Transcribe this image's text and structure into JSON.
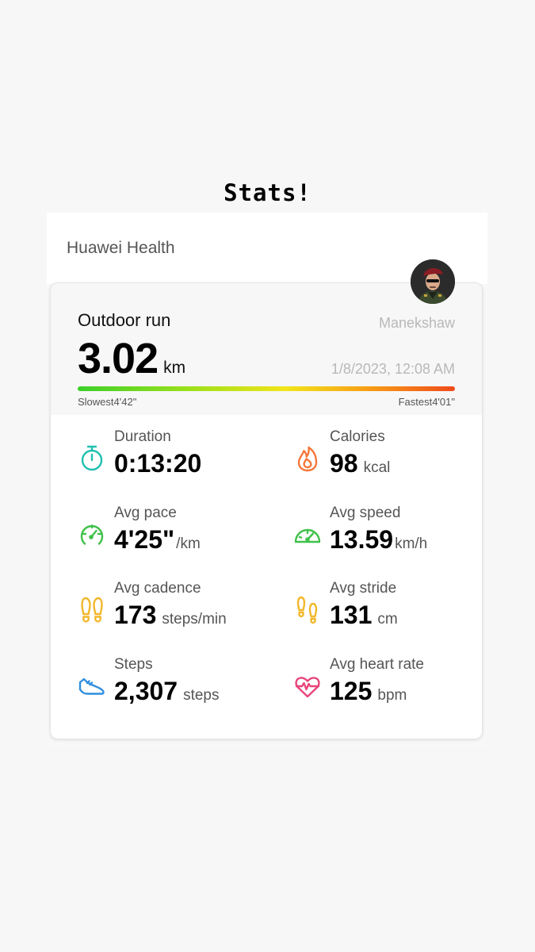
{
  "caption": "Stats!",
  "app": {
    "name": "Huawei Health"
  },
  "workout": {
    "title": "Outdoor run",
    "distance": "3.02",
    "distance_unit": "km",
    "user": "Manekshaw",
    "datetime": "1/8/2023, 12:08 AM",
    "pace_bar": {
      "slowest": "Slowest4'42\"",
      "fastest": "Fastest4'01\""
    }
  },
  "stats": [
    {
      "label": "Duration",
      "value": "0:13:20",
      "unit": "",
      "icon": "stopwatch-icon",
      "color": "#20c0b0"
    },
    {
      "label": "Calories",
      "value": "98",
      "unit": "kcal",
      "icon": "flame-icon",
      "color": "#f5773b"
    },
    {
      "label": "Avg pace",
      "value": "4'25\"",
      "unit": "/km",
      "icon": "pace-gauge-icon",
      "color": "#3fc14a"
    },
    {
      "label": "Avg speed",
      "value": "13.59",
      "unit": "km/h",
      "icon": "speedometer-icon",
      "color": "#3fc14a"
    },
    {
      "label": "Avg cadence",
      "value": "173",
      "unit": "steps/min",
      "icon": "footprints-icon",
      "color": "#f2b72b"
    },
    {
      "label": "Avg stride",
      "value": "131",
      "unit": "cm",
      "icon": "stride-footprints-icon",
      "color": "#f2b72b"
    },
    {
      "label": "Steps",
      "value": "2,307",
      "unit": "steps",
      "icon": "running-shoe-icon",
      "color": "#2f8fe0"
    },
    {
      "label": "Avg heart rate",
      "value": "125",
      "unit": "bpm",
      "icon": "heart-rate-icon",
      "color": "#e8457a"
    }
  ]
}
